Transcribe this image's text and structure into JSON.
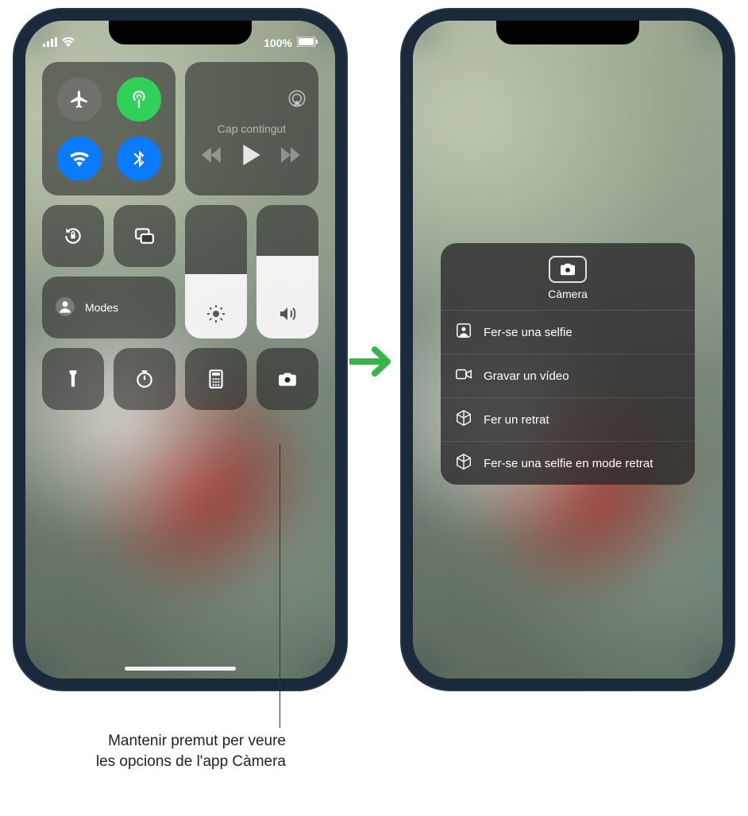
{
  "status": {
    "battery_text": "100%"
  },
  "control_center": {
    "media_title": "Cap contingut",
    "focus_label": "Modes",
    "brightness_percent": 48,
    "volume_percent": 62
  },
  "camera_menu": {
    "title": "Càmera",
    "items": [
      {
        "icon": "person-square",
        "label": "Fer-se una selfie"
      },
      {
        "icon": "video",
        "label": "Gravar un vídeo"
      },
      {
        "icon": "cube",
        "label": "Fer un retrat"
      },
      {
        "icon": "cube",
        "label": "Fer-se una selfie en mode retrat"
      }
    ]
  },
  "callout": "Mantenir premut per veure les opcions de l'app Càmera"
}
